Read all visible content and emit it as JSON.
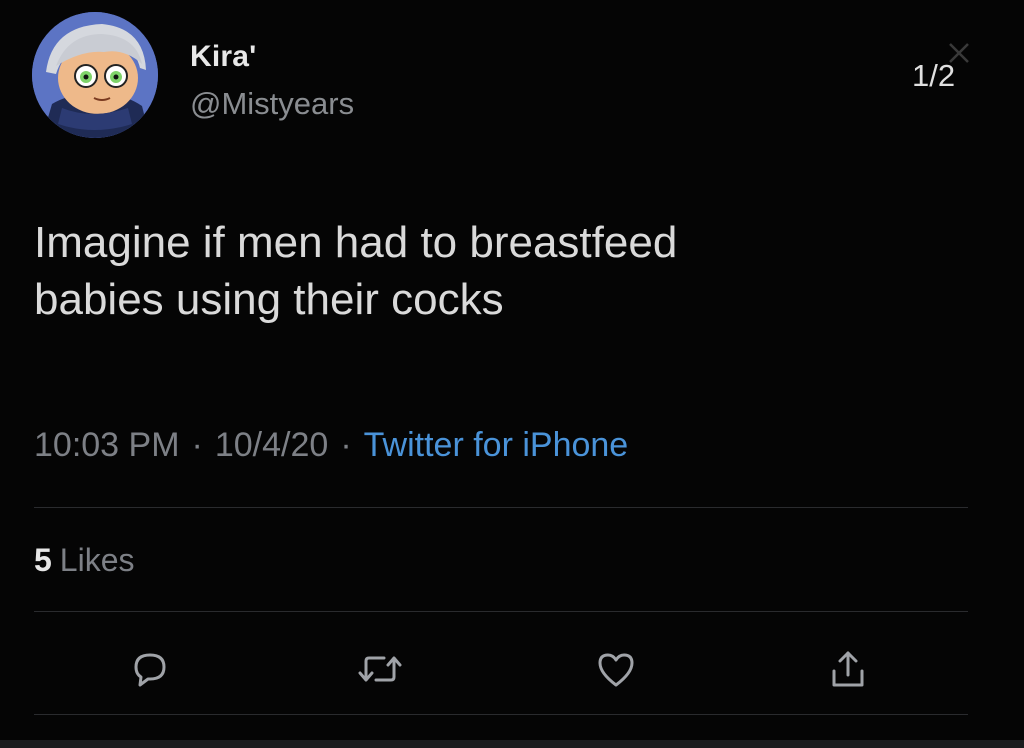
{
  "user": {
    "display_name": "Kira'",
    "handle": "@Mistyears",
    "avatar_icon": "cartoon-avatar"
  },
  "viewer": {
    "page_indicator": "1/2"
  },
  "tweet": {
    "text_lines": [
      "Imagine if men had to breastfeed",
      "babies using their cocks"
    ],
    "time": "10:03 PM",
    "separator": "·",
    "date": "10/4/20",
    "source": "Twitter for iPhone"
  },
  "stats": {
    "likes_count": "5",
    "likes_label": "Likes"
  },
  "actions": [
    {
      "name": "reply",
      "icon": "reply-icon"
    },
    {
      "name": "retweet",
      "icon": "retweet-icon"
    },
    {
      "name": "like",
      "icon": "heart-icon"
    },
    {
      "name": "share",
      "icon": "share-icon"
    }
  ],
  "colors": {
    "background": "#050505",
    "text": "#dadada",
    "muted": "#7d8086",
    "link": "#4a93d9",
    "divider": "#2a2b2e"
  }
}
